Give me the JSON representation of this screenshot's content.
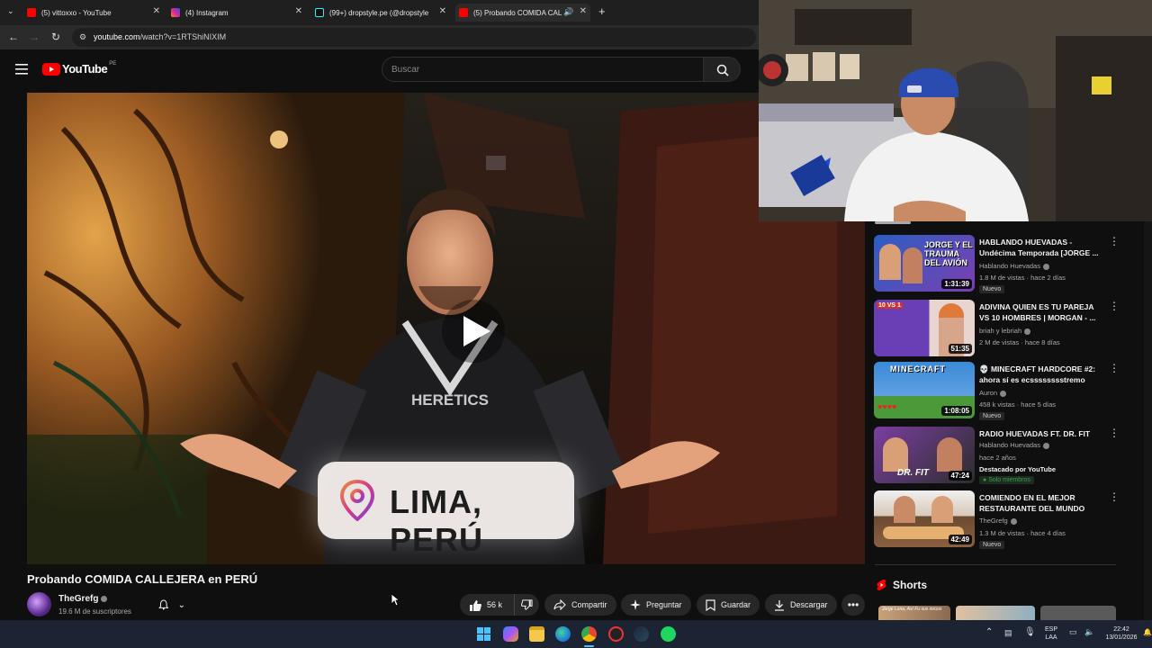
{
  "browser": {
    "tabs": [
      {
        "label": "(5) vittoxxo - YouTube",
        "favicon_color": "#ff0000"
      },
      {
        "label": "(4) Instagram",
        "favicon_color": "#d6249f"
      },
      {
        "label": "(99+) dropstyle.pe (@dropstyle",
        "favicon_color": "#111111"
      },
      {
        "label": "(5) Probando COMIDA CAL",
        "favicon_color": "#ff0000"
      }
    ],
    "url_host": "youtube.com",
    "url_path": "/watch?v=1RTShiNIXIM"
  },
  "youtube": {
    "logo_text": "YouTube",
    "country_code": "PE",
    "search_placeholder": "Buscar"
  },
  "video": {
    "overlay_location": "LIMA, PERÚ",
    "shirt_text": "HERETICS",
    "title": "Probando COMIDA CALLEJERA en PERÚ",
    "channel": "TheGrefg",
    "subscribers": "19.6 M de suscriptores",
    "likes": "56 k",
    "actions": {
      "share": "Compartir",
      "ask": "Preguntar",
      "save": "Guardar",
      "download": "Descargar"
    }
  },
  "recommendations": [
    {
      "title": "HABLANDO HUEVADAS - Undécima Temporada [JORGE ...",
      "channel": "Hablando Huevadas",
      "meta": "1.8 M de vistas · hace 2 días",
      "badge": "Nuevo",
      "duration": "1:31:39",
      "thumb_text": "JORGE Y EL TRAUMA DEL AVIÓN",
      "colors": [
        "#2a5fc4",
        "#7b3fb0"
      ]
    },
    {
      "title": "ADIVINA QUIEN ES TU PAREJA VS 10 HOMBRES | MORGAN - ...",
      "channel": "briah y lebriah",
      "meta": "2 M de vistas · hace 8 días",
      "badge": "",
      "duration": "51:35",
      "thumb_text": "10 VS 1",
      "colors": [
        "#6a3fb5",
        "#e8d5d0"
      ]
    },
    {
      "title": "💀 MINECRAFT HARDCORE #2: ahora sí es ecsssssssstremo",
      "channel": "Auron",
      "meta": "458 k vistas · hace 5 días",
      "badge": "Nuevo",
      "duration": "1:08:05",
      "thumb_text": "MINECRAFT",
      "colors": [
        "#3b8ad8",
        "#4a9a3a"
      ]
    },
    {
      "title": "RADIO HUEVADAS FT. DR. FIT",
      "channel": "Hablando Huevadas",
      "meta": "hace 2 años",
      "badge": "Destacado por YouTube",
      "badge2": "Solo miembros",
      "duration": "47:24",
      "thumb_text": "DR. FIT",
      "colors": [
        "#7a3fa0",
        "#2d2d2d"
      ]
    },
    {
      "title": "COMIENDO EN EL MEJOR RESTAURANTE DEL MUNDO",
      "channel": "TheGrefg",
      "meta": "1.3 M de vistas · hace 4 días",
      "badge": "Nuevo",
      "duration": "42:49",
      "thumb_text": "",
      "colors": [
        "#6b4a30",
        "#c9a27a"
      ]
    }
  ],
  "shorts_label": "Shorts",
  "shorts_thumb_text": "Jorge Luna, Así Fu sus inicios",
  "taskbar": {
    "lang_top": "ESP",
    "lang_bottom": "LAA",
    "time": "22:42",
    "date": "13/01/2026"
  }
}
